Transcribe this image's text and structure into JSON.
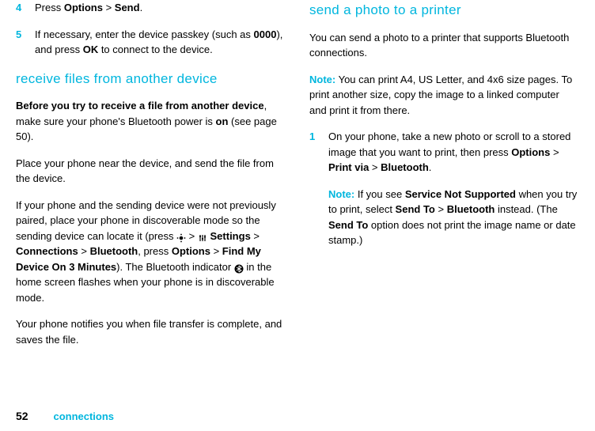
{
  "left": {
    "step4": {
      "num": "4",
      "pre": "Press ",
      "opt": "Options",
      "gt": " > ",
      "send": "Send",
      "post": "."
    },
    "step5": {
      "num": "5",
      "line1_pre": "If necessary, enter the device passkey (such as ",
      "code": "0000",
      "line1_mid": "), and press ",
      "ok": "OK",
      "line1_post": " to connect to the device."
    },
    "heading1": "receive files from another device",
    "p1_strong": "Before you try to receive a file from another device",
    "p1_rest1": ", make sure your phone's Bluetooth power is ",
    "p1_on": "on",
    "p1_rest2": " (see page 50).",
    "p2": "Place your phone near the device, and send the file from the device.",
    "p3_a": "If your phone and the sending device were not previously paired, place your phone in discoverable mode so the sending device can locate it (press ",
    "p3_gt1": " > ",
    "p3_settings": "Settings",
    "p3_gt2": " > ",
    "p3_conn": "Connections",
    "p3_gt3": " > ",
    "p3_bt": "Bluetooth",
    "p3_mid": ", press ",
    "p3_opt": "Options",
    "p3_gt4": " > ",
    "p3_find": "Find My Device On 3 Minutes",
    "p3_b": "). The Bluetooth indicator ",
    "p3_c": " in the home screen flashes when your phone is in discoverable mode.",
    "p4": "Your phone notifies you when file transfer is complete, and saves the file."
  },
  "right": {
    "heading2": "send a photo to a printer",
    "r1": "You can send a photo to a printer that supports Bluetooth connections.",
    "r2_note": "Note:",
    "r2": " You can print A4, US Letter, and 4x6 size pages. To print another size, copy the image to a linked computer and print it from there.",
    "step1": {
      "num": "1",
      "a": "On your phone, take a new photo or scroll to a stored image that you want to print, then press ",
      "opt": "Options",
      "gt1": " > ",
      "pv": "Print via",
      "gt2": " > ",
      "bt": "Bluetooth",
      "post": "."
    },
    "sub": {
      "note": "Note:",
      "a": " If you see ",
      "sns": "Service Not Supported",
      "b": " when you try to print, select ",
      "sendto": "Send To",
      "gt": " > ",
      "bt": "Bluetooth",
      "c": " instead. (The ",
      "sendto2": "Send To",
      "d": " option does not print the image name or date stamp.)"
    }
  },
  "footer": {
    "page": "52",
    "label": "connections"
  }
}
